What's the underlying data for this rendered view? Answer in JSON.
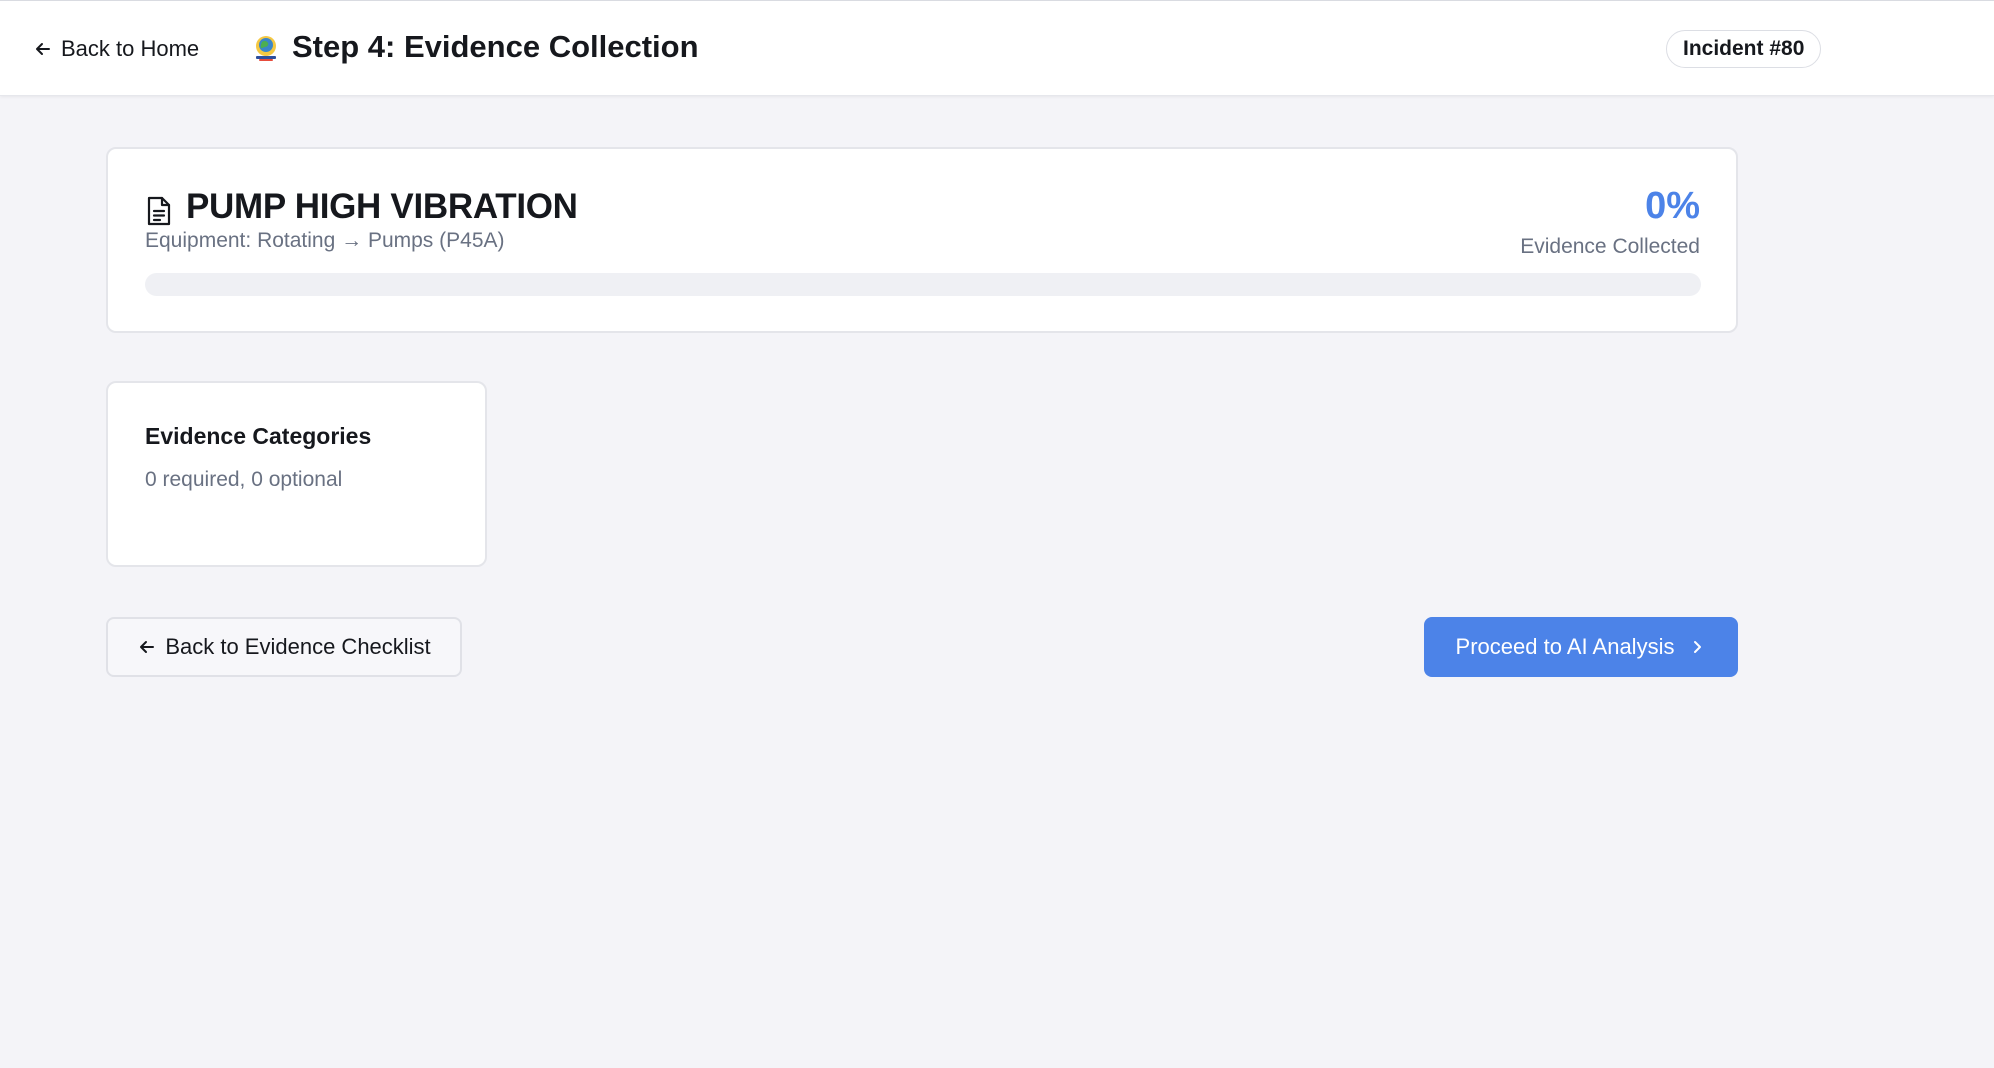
{
  "header": {
    "back_label": "Back to Home",
    "title": "Step 4: Evidence Collection",
    "incident_badge": "Incident #80"
  },
  "summary": {
    "title": "PUMP HIGH VIBRATION",
    "equipment": "Equipment: Rotating → Pumps (P45A)",
    "percent": "0%",
    "percent_label": "Evidence Collected",
    "progress_fraction": 0
  },
  "categories": {
    "title": "Evidence Categories",
    "subtitle": "0 required, 0 optional"
  },
  "actions": {
    "back_label": "Back to Evidence Checklist",
    "proceed_label": "Proceed to AI Analysis"
  },
  "colors": {
    "accent": "#4c83e8",
    "muted_text": "#697182",
    "background": "#f4f4f8"
  },
  "icons": {
    "back_home": "arrow-left-icon",
    "logo": "globe-logo-icon",
    "document": "document-icon",
    "back_checklist": "arrow-left-icon",
    "proceed": "chevron-right-icon"
  }
}
